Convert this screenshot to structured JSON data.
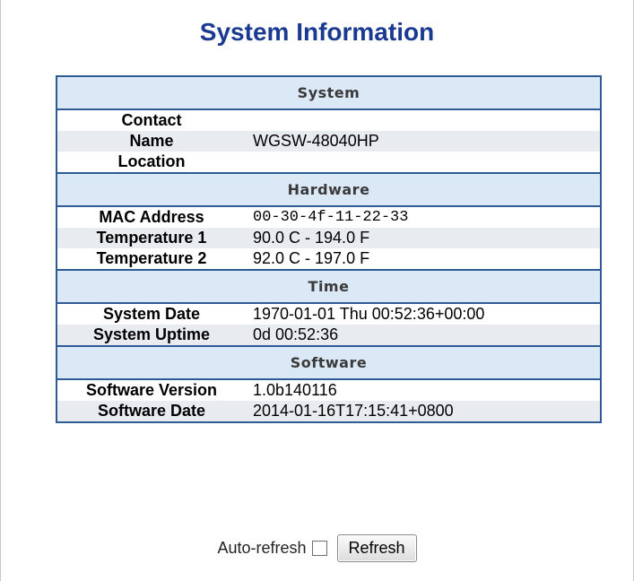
{
  "page": {
    "title": "System Information"
  },
  "sections": {
    "system": {
      "header": "System",
      "contact_label": "Contact",
      "contact_value": "",
      "name_label": "Name",
      "name_value": "WGSW-48040HP",
      "location_label": "Location",
      "location_value": ""
    },
    "hardware": {
      "header": "Hardware",
      "mac_label": "MAC Address",
      "mac_value": "00-30-4f-11-22-33",
      "temp1_label": "Temperature 1",
      "temp1_value": "90.0 C - 194.0 F",
      "temp2_label": "Temperature 2",
      "temp2_value": "92.0 C - 197.0 F"
    },
    "time": {
      "header": "Time",
      "date_label": "System Date",
      "date_value": "1970-01-01 Thu 00:52:36+00:00",
      "uptime_label": "System Uptime",
      "uptime_value": "0d 00:52:36"
    },
    "software": {
      "header": "Software",
      "version_label": "Software Version",
      "version_value": "1.0b140116",
      "date_label": "Software Date",
      "date_value": "2014-01-16T17:15:41+0800"
    }
  },
  "controls": {
    "auto_refresh_label": "Auto-refresh",
    "auto_refresh_checked": false,
    "refresh_button": "Refresh"
  },
  "colors": {
    "title": "#1a3a92",
    "section_header_bg": "#dbe8f6",
    "table_border": "#2e5b96",
    "alt_row_bg": "#e8ecf1"
  }
}
